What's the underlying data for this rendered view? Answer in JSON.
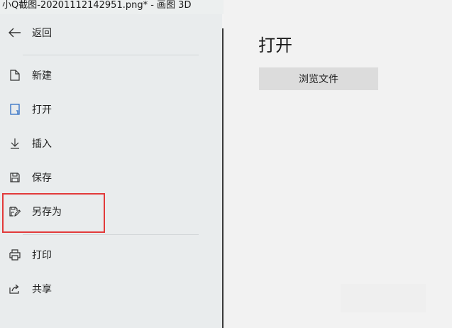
{
  "window": {
    "title": "小Q截图-20201112142951.png* - 画图 3D"
  },
  "sidebar": {
    "back": {
      "label": "返回",
      "icon": "arrow-left-icon"
    },
    "items": [
      {
        "label": "新建",
        "icon": "new-file-icon"
      },
      {
        "label": "打开",
        "icon": "open-file-icon"
      },
      {
        "label": "插入",
        "icon": "insert-arrow-icon"
      },
      {
        "label": "保存",
        "icon": "save-icon"
      },
      {
        "label": "另存为",
        "icon": "save-as-icon"
      },
      {
        "label": "打印",
        "icon": "print-icon"
      },
      {
        "label": "共享",
        "icon": "share-icon"
      }
    ]
  },
  "main": {
    "title": "打开",
    "browse_button": "浏览文件"
  },
  "colors": {
    "highlight": "#e23a3a",
    "accent": "#2b6cc4"
  }
}
